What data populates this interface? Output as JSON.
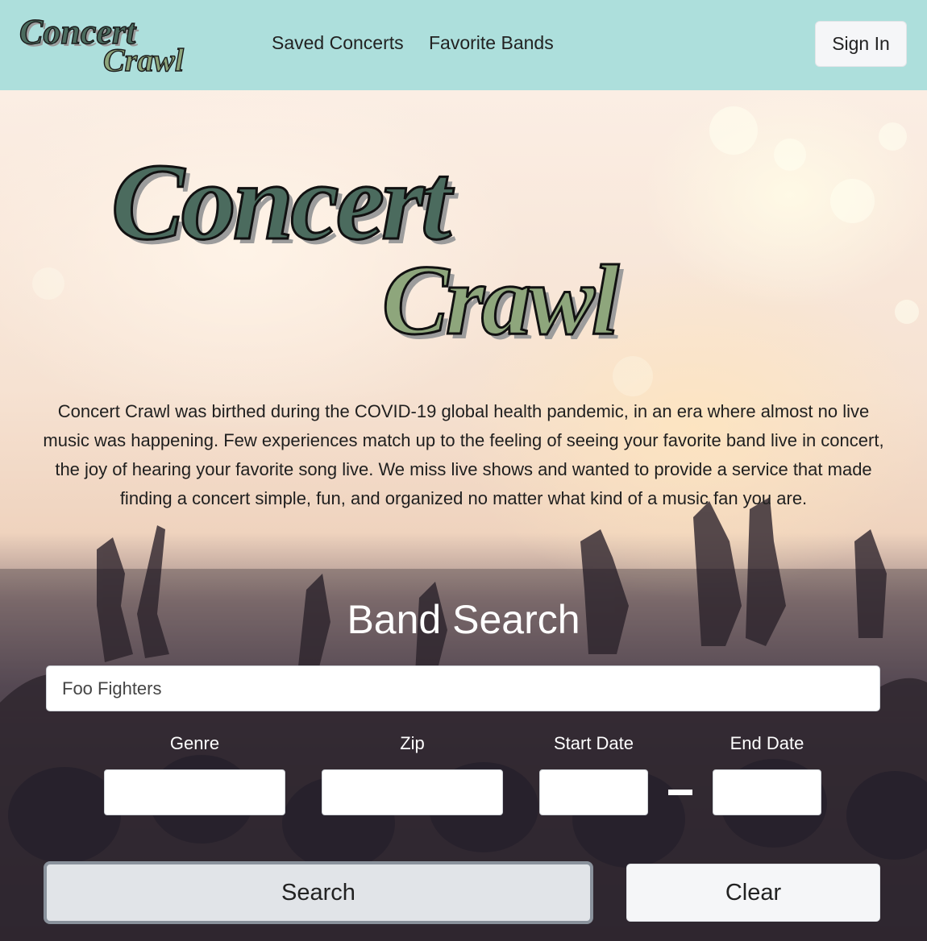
{
  "navbar": {
    "logo_text_top": "Concert",
    "logo_text_bottom": "Crawl",
    "links": [
      "Saved Concerts",
      "Favorite Bands"
    ],
    "sign_in_label": "Sign In"
  },
  "hero": {
    "logo_text_top": "Concert",
    "logo_text_bottom": "Crawl",
    "about_text": "Concert Crawl was birthed during the COVID-19 global health pandemic, in an era where almost no live music was happening. Few experiences match up to the feeling of seeing your favorite band live in concert, the joy of hearing your favorite song live. We miss live shows and wanted to provide a service that made finding a concert simple, fun, and organized no matter what kind of a music fan you are."
  },
  "band_search": {
    "title": "Band Search",
    "band_value": "Foo Fighters",
    "fields": {
      "genre_label": "Genre",
      "zip_label": "Zip",
      "start_date_label": "Start Date",
      "end_date_label": "End Date",
      "genre_value": "",
      "zip_value": "",
      "start_date_value": "",
      "end_date_value": ""
    },
    "search_label": "Search",
    "clear_label": "Clear"
  },
  "colors": {
    "navbar_bg": "#addfdc",
    "logo_dark_green": "#4b6b5e",
    "logo_sage": "#8ea67c",
    "logo_slate": "#8fa3ad"
  },
  "icons": [
    "concert-crawl-logo"
  ]
}
